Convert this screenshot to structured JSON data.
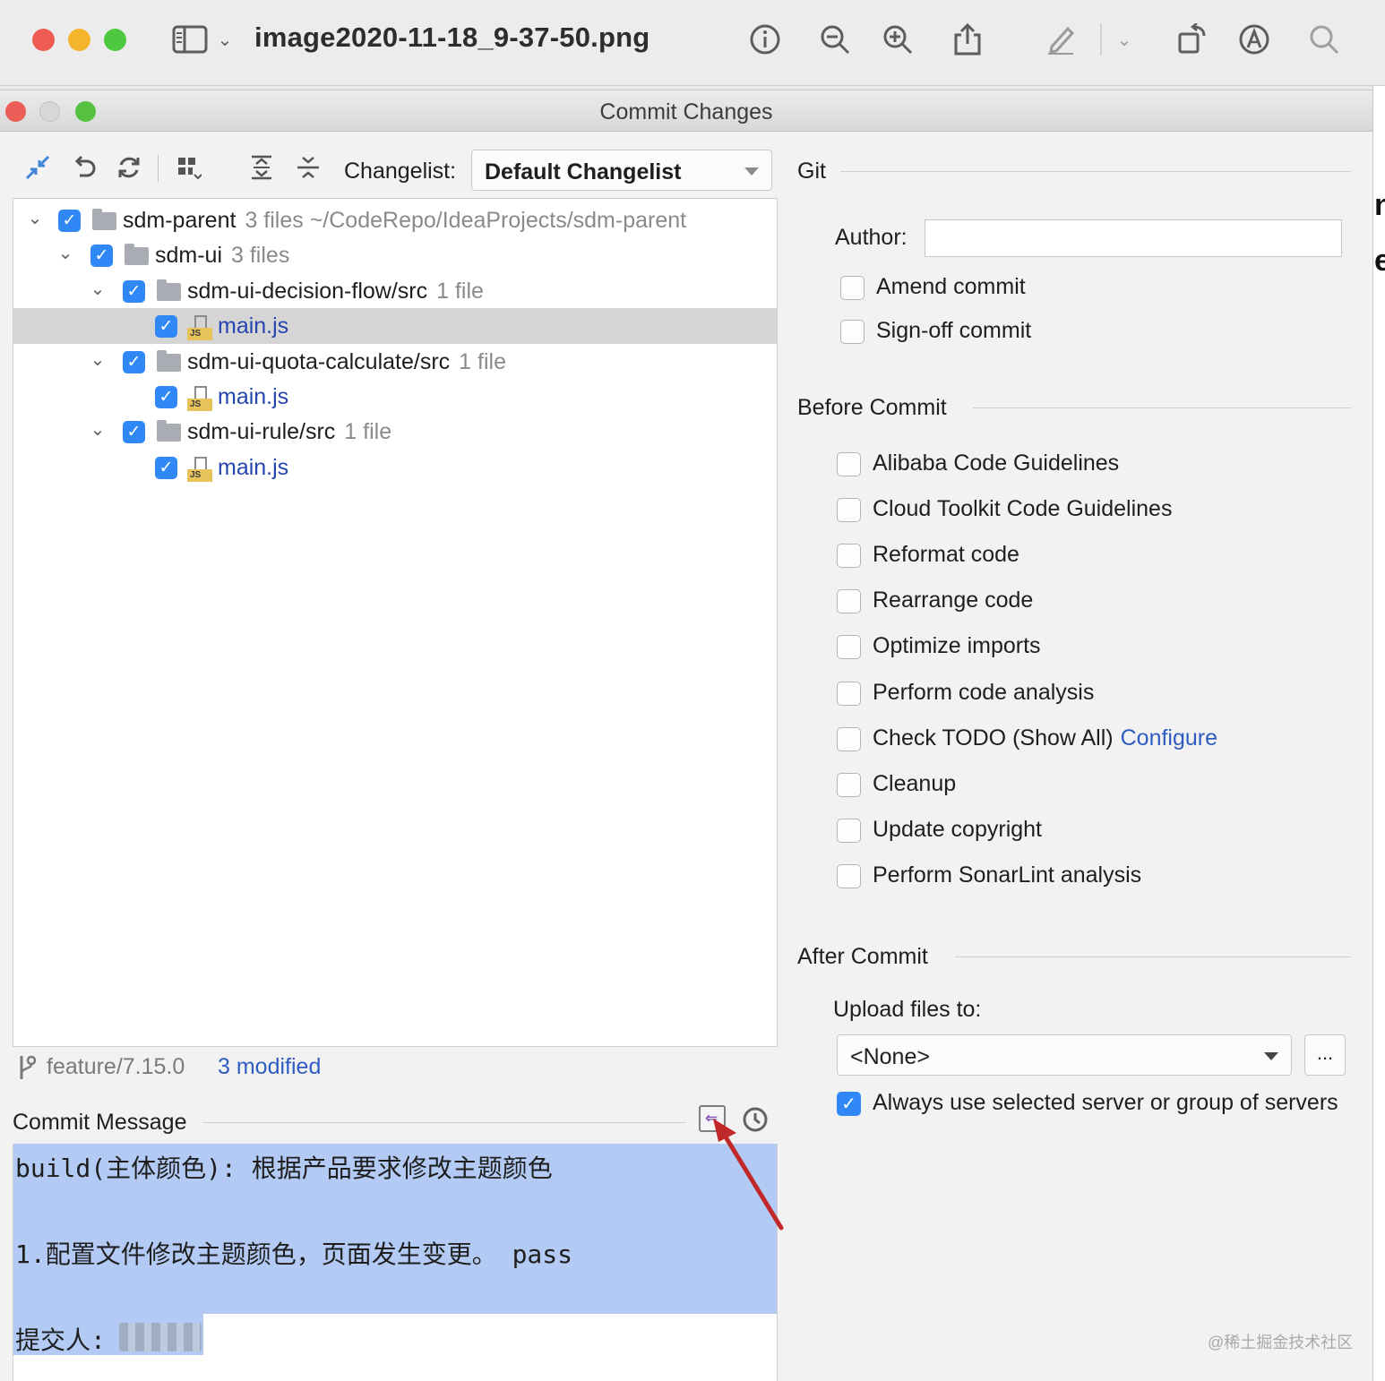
{
  "preview": {
    "filename": "image2020-11-18_9-37-50.png",
    "icons": [
      "sidebar-icon",
      "chevron-down-icon",
      "info-icon",
      "zoom-out-icon",
      "zoom-in-icon",
      "share-icon",
      "markup-pen-icon",
      "chevron-down-icon",
      "rotate-icon",
      "annotate-icon",
      "search-icon"
    ]
  },
  "dialog": {
    "title": "Commit Changes"
  },
  "toolbar": {
    "changelist_label": "Changelist:",
    "changelist_value": "Default Changelist"
  },
  "tree": [
    {
      "level": 0,
      "kind": "module",
      "name": "sdm-parent",
      "meta": "3 files  ~/CodeRepo/IdeaProjects/sdm-parent",
      "checked": true,
      "expanded": true
    },
    {
      "level": 1,
      "kind": "folder",
      "name": "sdm-ui",
      "meta": "3 files",
      "checked": true,
      "expanded": true
    },
    {
      "level": 2,
      "kind": "folder",
      "name": "sdm-ui-decision-flow/src",
      "meta": "1 file",
      "checked": true,
      "expanded": true
    },
    {
      "level": 3,
      "kind": "file",
      "name": "main.js",
      "meta": "",
      "checked": true,
      "selected": true
    },
    {
      "level": 2,
      "kind": "folder",
      "name": "sdm-ui-quota-calculate/src",
      "meta": "1 file",
      "checked": true,
      "expanded": true
    },
    {
      "level": 3,
      "kind": "file",
      "name": "main.js",
      "meta": "",
      "checked": true
    },
    {
      "level": 2,
      "kind": "folder",
      "name": "sdm-ui-rule/src",
      "meta": "1 file",
      "checked": true,
      "expanded": true
    },
    {
      "level": 3,
      "kind": "file",
      "name": "main.js",
      "meta": "",
      "checked": true
    }
  ],
  "status": {
    "branch": "feature/7.15.0",
    "modified": "3 modified"
  },
  "commit_message": {
    "title": "Commit Message",
    "lines": [
      "build(主体颜色): 根据产品要求修改主题颜色",
      "",
      "1.配置文件修改主题颜色，页面发生变更。 pass",
      "",
      "提交人:"
    ]
  },
  "git": {
    "title": "Git",
    "author_label": "Author:",
    "author_value": "",
    "options": [
      {
        "label": "Amend commit",
        "checked": false
      },
      {
        "label": "Sign-off commit",
        "checked": false
      }
    ]
  },
  "before_commit": {
    "title": "Before Commit",
    "options": [
      {
        "label": "Alibaba Code Guidelines",
        "checked": false
      },
      {
        "label": "Cloud Toolkit Code Guidelines",
        "checked": false
      },
      {
        "label": "Reformat code",
        "checked": false
      },
      {
        "label": "Rearrange code",
        "checked": false
      },
      {
        "label": "Optimize imports",
        "checked": false
      },
      {
        "label": "Perform code analysis",
        "checked": false
      },
      {
        "label": "Check TODO (Show All)",
        "link": "Configure",
        "checked": false
      },
      {
        "label": "Cleanup",
        "checked": false
      },
      {
        "label": "Update copyright",
        "checked": false
      },
      {
        "label": "Perform SonarLint analysis",
        "checked": false
      }
    ]
  },
  "after_commit": {
    "title": "After Commit",
    "upload_label": "Upload files to:",
    "upload_value": "<None>",
    "browse_label": "...",
    "always_label": "Always use selected server or group of servers",
    "always_checked": true
  },
  "watermark": "@稀土掘金技术社区",
  "colors": {
    "accent": "#2f88f5",
    "link": "#2f5cc2",
    "selection": "#b3cbf4",
    "arrow": "#c0282a"
  }
}
